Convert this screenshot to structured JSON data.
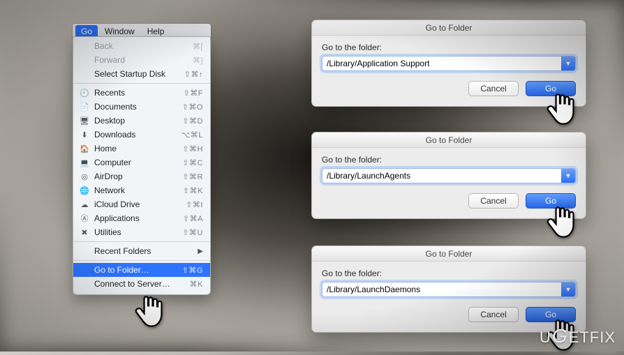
{
  "menubar": {
    "go": "Go",
    "window": "Window",
    "help": "Help"
  },
  "menu": {
    "back": {
      "label": "Back",
      "shortcut": "⌘["
    },
    "forward": {
      "label": "Forward",
      "shortcut": "⌘]"
    },
    "startup": {
      "label": "Select Startup Disk",
      "shortcut": "⇧⌘↑"
    },
    "recents": {
      "label": "Recents",
      "shortcut": "⇧⌘F"
    },
    "documents": {
      "label": "Documents",
      "shortcut": "⇧⌘O"
    },
    "desktop": {
      "label": "Desktop",
      "shortcut": "⇧⌘D"
    },
    "downloads": {
      "label": "Downloads",
      "shortcut": "⌥⌘L"
    },
    "home": {
      "label": "Home",
      "shortcut": "⇧⌘H"
    },
    "computer": {
      "label": "Computer",
      "shortcut": "⇧⌘C"
    },
    "airdrop": {
      "label": "AirDrop",
      "shortcut": "⇧⌘R"
    },
    "network": {
      "label": "Network",
      "shortcut": "⇧⌘K"
    },
    "icloud": {
      "label": "iCloud Drive",
      "shortcut": "⇧⌘I"
    },
    "applications": {
      "label": "Applications",
      "shortcut": "⇧⌘A"
    },
    "utilities": {
      "label": "Utilities",
      "shortcut": "⇧⌘U"
    },
    "recentfolders": {
      "label": "Recent Folders"
    },
    "gotofolder": {
      "label": "Go to Folder…",
      "shortcut": "⇧⌘G"
    },
    "connect": {
      "label": "Connect to Server…",
      "shortcut": "⌘K"
    }
  },
  "dialog": {
    "title": "Go to Folder",
    "prompt": "Go to the folder:",
    "cancel": "Cancel",
    "go": "Go"
  },
  "dialogs": [
    {
      "value": "/Library/Application Support"
    },
    {
      "value": "/Library/LaunchAgents"
    },
    {
      "value": "/Library/LaunchDaemons"
    }
  ],
  "watermark": {
    "u": "U",
    "g": "G",
    "rest": "ETFIX"
  }
}
